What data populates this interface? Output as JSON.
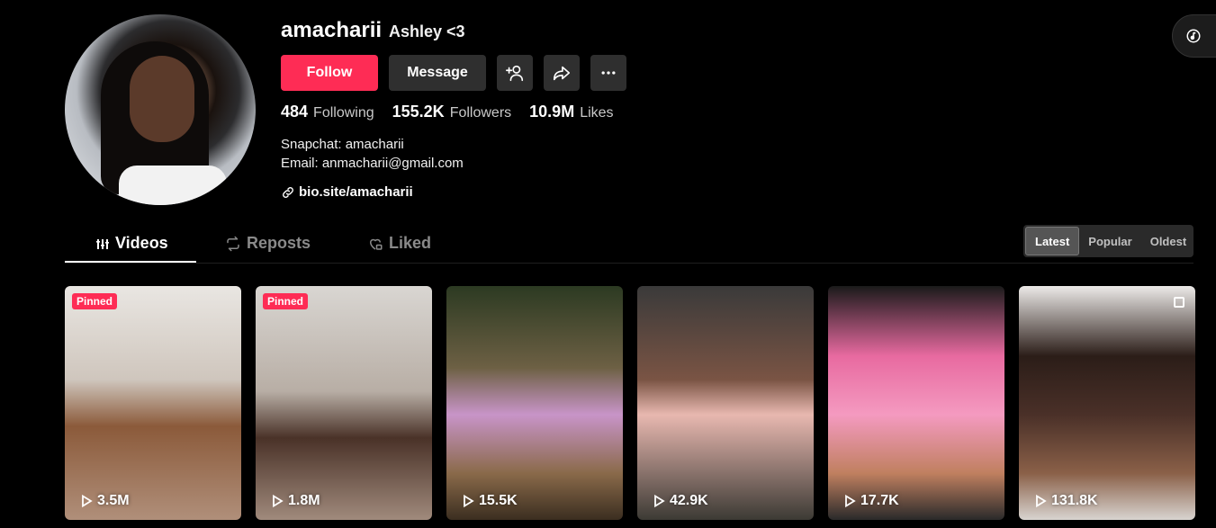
{
  "profile": {
    "username": "amacharii",
    "nickname": "Ashley <3",
    "follow_label": "Follow",
    "message_label": "Message",
    "stats": {
      "following": "484",
      "following_label": "Following",
      "followers": "155.2K",
      "followers_label": "Followers",
      "likes": "10.9M",
      "likes_label": "Likes"
    },
    "bio_line1": "Snapchat: amacharii",
    "bio_line2": "Email: anmacharii@gmail.com",
    "link": "bio.site/amacharii"
  },
  "tabs": {
    "videos": "Videos",
    "reposts": "Reposts",
    "liked": "Liked"
  },
  "sort": {
    "latest": "Latest",
    "popular": "Popular",
    "oldest": "Oldest"
  },
  "videos": [
    {
      "views": "3.5M",
      "pinned": "Pinned"
    },
    {
      "views": "1.8M",
      "pinned": "Pinned"
    },
    {
      "views": "15.5K"
    },
    {
      "views": "42.9K"
    },
    {
      "views": "17.7K"
    },
    {
      "views": "131.8K"
    }
  ],
  "colors": {
    "accent": "#fe2c55",
    "background": "#000000",
    "button": "#2f2f2f"
  }
}
